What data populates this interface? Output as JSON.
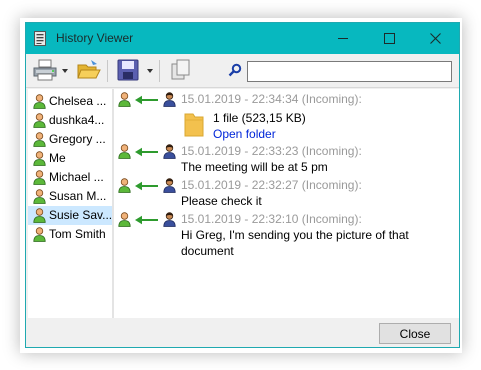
{
  "window": {
    "title": "History Viewer"
  },
  "colors": {
    "titlebar": "#07b8bf",
    "arrow": "#2e9b2e",
    "link": "#0026d9",
    "timestamp": "#9a9a9a",
    "selected": "#cce8ff"
  },
  "toolbar": {
    "icons": [
      "printer-icon",
      "open-folder-icon",
      "save-icon",
      "copy-icon",
      "search-icon"
    ],
    "search_value": ""
  },
  "contacts": [
    {
      "name": "Chelsea ..."
    },
    {
      "name": "dushka4..."
    },
    {
      "name": "Gregory ..."
    },
    {
      "name": "Me"
    },
    {
      "name": "Michael ..."
    },
    {
      "name": "Susan M..."
    },
    {
      "name": "Susie Sav..."
    },
    {
      "name": "Tom Smith"
    }
  ],
  "selected_contact": "Susie Sav...",
  "messages": [
    {
      "meta": "15.01.2019 - 22:34:34 (Incoming):",
      "file": {
        "label": "1 file (523,15 KB)",
        "link": "Open folder"
      }
    },
    {
      "meta": "15.01.2019 - 22:33:23 (Incoming):",
      "lines": [
        "The meeting will be at 5 pm"
      ]
    },
    {
      "meta": "15.01.2019 - 22:32:27 (Incoming):",
      "lines": [
        "Please check it"
      ]
    },
    {
      "meta": "15.01.2019 - 22:32:10 (Incoming):",
      "lines": [
        "Hi Greg, I'm sending you the picture of that",
        "document"
      ]
    }
  ],
  "footer": {
    "close_label": "Close"
  }
}
